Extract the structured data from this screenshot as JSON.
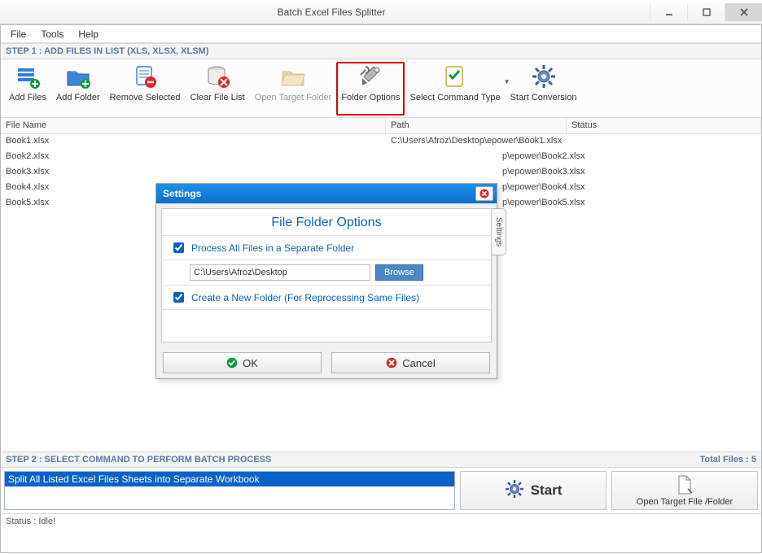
{
  "window": {
    "title": "Batch Excel Files Splitter"
  },
  "menu": {
    "file": "File",
    "tools": "Tools",
    "help": "Help"
  },
  "step1": {
    "label": "STEP 1 : ADD FILES IN LIST (XLS, XLSX, XLSM)"
  },
  "toolbar": {
    "add_files": "Add Files",
    "add_folder": "Add Folder",
    "remove_selected": "Remove Selected",
    "clear_list": "Clear File List",
    "open_target": "Open Target Folder",
    "folder_options": "Folder Options",
    "select_command": "Select Command Type",
    "start_conversion": "Start Conversion"
  },
  "columns": {
    "file": "File Name",
    "path": "Path",
    "status": "Status"
  },
  "rows": [
    {
      "file": "Book1.xlsx",
      "path": "C:\\Users\\Afroz\\Desktop\\epower\\Book1.xlsx"
    },
    {
      "file": "Book2.xlsx",
      "path": "p\\epower\\Book2.xlsx"
    },
    {
      "file": "Book3.xlsx",
      "path": "p\\epower\\Book3.xlsx"
    },
    {
      "file": "Book4.xlsx",
      "path": "p\\epower\\Book4.xlsx"
    },
    {
      "file": "Book5.xlsx",
      "path": "p\\epower\\Book5.xlsx"
    }
  ],
  "step2": {
    "label": "STEP 2 : SELECT COMMAND TO PERFORM BATCH PROCESS",
    "total": "Total Files : 5",
    "selected_command": "Split All Listed Excel Files Sheets into Separate Workbook",
    "start": "Start",
    "open_target": "Open Target File /Folder"
  },
  "status": {
    "text": "Status  :  Idle!"
  },
  "dialog": {
    "title": "Settings",
    "heading": "File Folder Options",
    "opt1": "Process All Files in a Separate Folder",
    "path": "C:\\Users\\Afroz\\Desktop",
    "browse": "Browse",
    "opt2": "Create a New Folder (For Reprocessing Same Files)",
    "ok": "OK",
    "cancel": "Cancel",
    "side_tab": "Settings"
  }
}
